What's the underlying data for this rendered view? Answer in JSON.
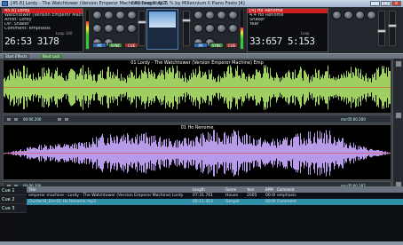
{
  "window": {
    "title": "[45.8] Lordy - The Watchtower (Version Emperor Machine)-Emp Stop 1",
    "cpu": "CPU usage: 6/25 % by Millennium II Piano Fosto [4]"
  },
  "deckA": {
    "header_title": "45.8] Lordy",
    "line2": "Watchtower (Version Emperor Machine)",
    "line3": "Artist: Lordy",
    "line4": "Dir: Shaker",
    "line5": "Comment: emphasis",
    "time": "26:53 3178",
    "remain": "Remain",
    "loop": "Loop 140"
  },
  "deckB": {
    "header_title": "[4] Ho Renome",
    "line2": "4.4 Ho Renome",
    "line3": "Shaker",
    "line4": "Year",
    "time": "33:657 5:153",
    "remain": "Remain",
    "loop": "Loop"
  },
  "center": {
    "pfl_a": "Pfl",
    "pfl_b": "Pfl",
    "sync_a": "SYNC",
    "sync_b": "SYNC",
    "cue_a": "CUE",
    "cue_b": "CUE"
  },
  "toolbar": {
    "left_btn": "Start Effects",
    "mid_btn": "Beat Lock"
  },
  "wave1": {
    "caption": "01 Lordy - The Watchtower (Version Emperor Machine)-Emp Stop 1",
    "caption2": "01 Lordy - The Watchtower (Version Emperor Machine) Emp",
    "pos": "00:00.200",
    "pos_right": "ms:05:00.200"
  },
  "wave2": {
    "caption": "01 Ho Renome",
    "pos": "00:00.200",
    "pos_right": "ms:05:00.287"
  },
  "cues": [
    "Cue 1",
    "Cue 2",
    "Cue 3"
  ],
  "playlist": {
    "headers": [
      "Title",
      "Length",
      "Genre",
      "Year",
      "BPM",
      "Comment"
    ],
    "rows": [
      {
        "title": "emperor machine - Lordy - The Watchtower (Version Emperor Machine) Lordy",
        "length": "07:31.761",
        "genre": "House",
        "year": "2005",
        "bpm": "00:00",
        "comment": "emphasis"
      },
      {
        "title": "Cluster-B_Em-01 Ho Renome.mp3",
        "length": "05:11.353",
        "genre": "Gospel",
        "year": "",
        "bpm": "00:00",
        "comment": "Comment"
      }
    ]
  },
  "colors": {
    "wave1": "#9fcf60",
    "wave2": "#b79be8",
    "selected": "#2f8ea8",
    "red": "#d11f1f"
  }
}
